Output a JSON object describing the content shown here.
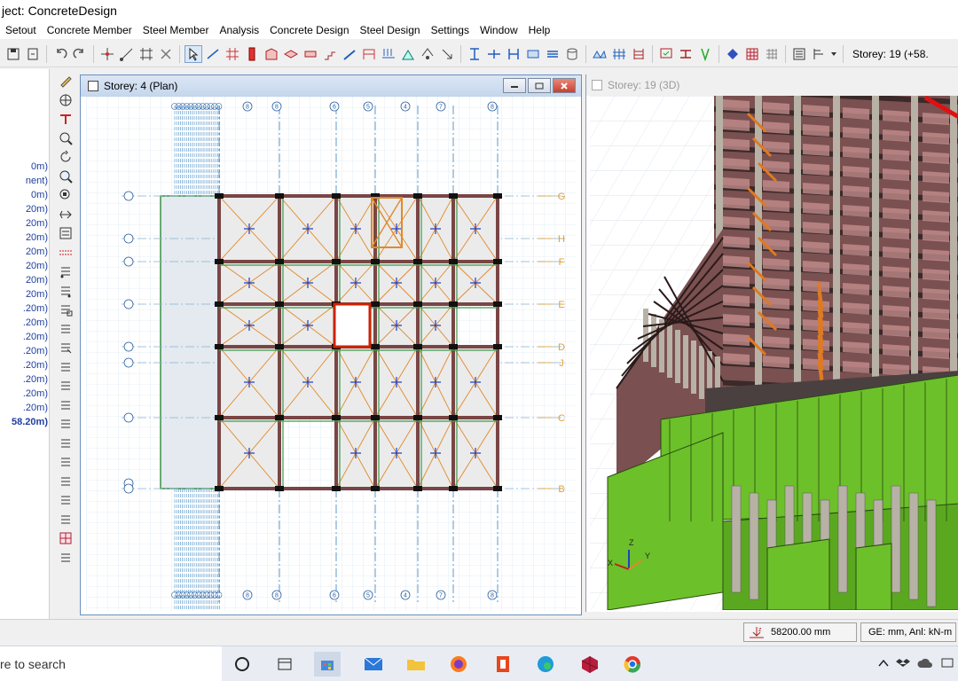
{
  "window": {
    "title": "ject: ConcreteDesign"
  },
  "menu": [
    "Setout",
    "Concrete Member",
    "Steel Member",
    "Analysis",
    "Concrete Design",
    "Steel Design",
    "Settings",
    "Window",
    "Help"
  ],
  "toolbar": {
    "storey_label": "Storey: 19 (+58."
  },
  "left_panel": {
    "storeys": [
      "0m)",
      "nent)",
      "0m)",
      "20m)",
      "20m)",
      "20m)",
      "20m)",
      "20m)",
      "20m)",
      "20m)",
      ".20m)",
      ".20m)",
      ".20m)",
      ".20m)",
      ".20m)",
      ".20m)",
      ".20m)",
      ".20m)",
      "58.20m)"
    ],
    "current_storey": "58.20m)"
  },
  "plan_window": {
    "title": "Storey: 4 (Plan)",
    "top_column_bubbles": [
      "8",
      "8",
      "6",
      "5",
      "4",
      "7",
      "8"
    ],
    "right_grid_labels": [
      "G",
      "H",
      "F",
      "E",
      "D",
      "J",
      "C",
      "B"
    ],
    "colors": {
      "grid_line": "#4a90c8",
      "beam": "#7a4545",
      "slab_hatch": "#e08a2a",
      "column": "#111111",
      "selected": "#cc2200",
      "wall": "#2e8b3a"
    }
  },
  "view3d_window": {
    "title": "Storey: 19 (3D)",
    "axis_labels": [
      "Z",
      "X",
      "Y"
    ],
    "colors": {
      "podium": "#6cc02a",
      "floor_slab": "#7a5050",
      "glass": "#c89090",
      "column": "#b8b2a6",
      "brace": "#e07a20",
      "highlight": "#e01010"
    }
  },
  "statusbar": {
    "elevation": "58200.00 mm",
    "units": "GE: mm,  Anl: kN-m"
  },
  "taskbar": {
    "search_text": "re to search"
  }
}
